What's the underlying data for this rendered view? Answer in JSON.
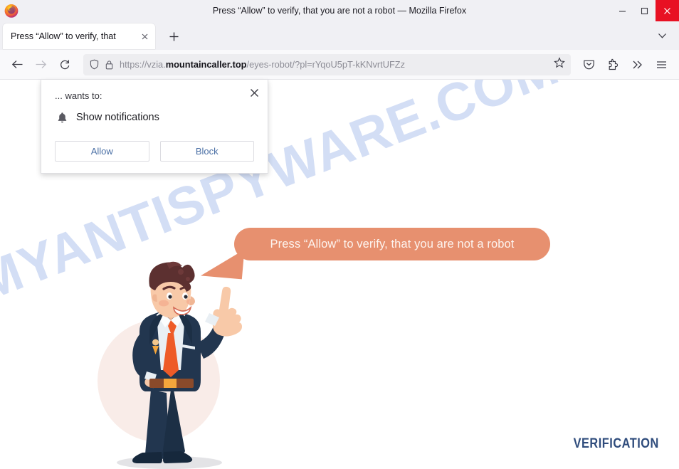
{
  "window": {
    "title": "Press “Allow” to verify, that you are not a robot — Mozilla Firefox",
    "minimize_label": "—",
    "maximize_label": "☐",
    "close_label": "✕",
    "accent_close": "#e81123",
    "titlebar_bg": "#f0f0f4"
  },
  "tabstrip": {
    "tabs": [
      {
        "label": "Press “Allow” to verify, that",
        "close_label": "✕"
      }
    ],
    "new_tab_label": "+",
    "list_all_tabs_label": "⌄"
  },
  "navbar": {
    "back_label": "←",
    "forward_label": "→",
    "reload_label": "↻",
    "url_scheme": "https://vzia.",
    "url_domain": "mountaincaller.top",
    "url_path": "/eyes-robot/?pl=rYqoU5pT-kKNvrtUFZz",
    "url_full": "https://vzia.mountaincaller.top/eyes-robot/?pl=rYqoU5pT-kKNvrtUFZz",
    "bookmark_label": "☆",
    "pocket_label": "pocket",
    "extensions_label": "extensions",
    "overflow_label": "»",
    "menu_label": "☰"
  },
  "dialog": {
    "host_text": "... wants to:",
    "permission_icon": "bell-icon",
    "permission_text": "Show notifications",
    "allow_label": "Allow",
    "block_label": "Block",
    "close_label": "✕",
    "button_text_color": "#4a6fa5"
  },
  "page": {
    "bubble_text": "Press “Allow” to verify, that you are not a robot",
    "bubble_color": "#e7906f",
    "bubble_text_color": "#fdf4ef",
    "watermark_text": "MYANTISPYWARE.COM",
    "watermark_color": "#d3def5",
    "verification_text": "VERIFICATION",
    "verification_color": "#2f4c7c",
    "circle_color": "#f9ece8",
    "suit_color": "#253a56",
    "tie_color": "#ee5b28",
    "skin_color": "#f8c9a8",
    "hair_color": "#5c3030"
  }
}
